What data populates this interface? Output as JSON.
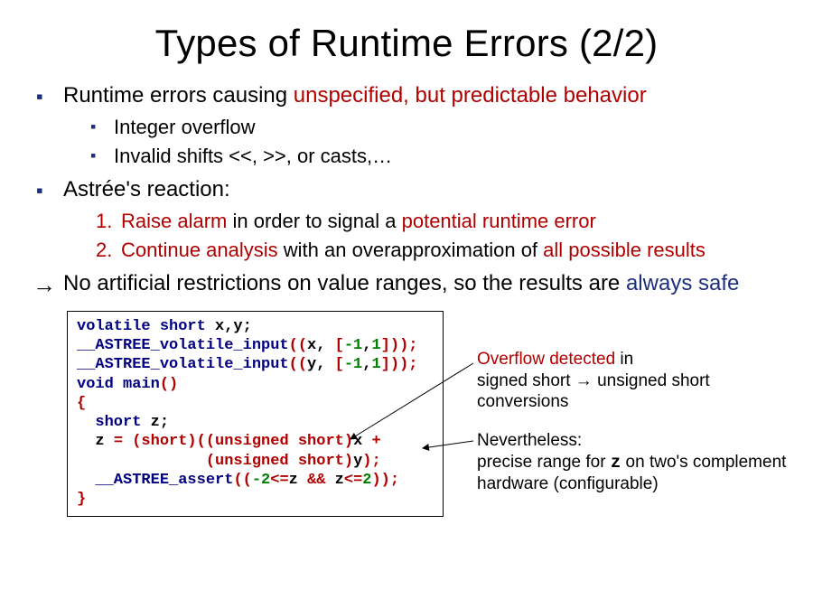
{
  "title": "Types of Runtime Errors (2/2)",
  "b1": {
    "pre": "Runtime errors causing ",
    "em": "unspecified, but predictable behavior",
    "sub1": "Integer overflow",
    "sub2": "Invalid shifts <<, >>, or casts,…"
  },
  "b2": {
    "text": "Astrée's reaction:",
    "n1a": "Raise alarm",
    "n1b": " in order to signal a ",
    "n1c": "potential runtime error",
    "n2a": "Continue analysis ",
    "n2b": "with an overapproximation of ",
    "n2c": "all possible results"
  },
  "b3": {
    "pre": "No artificial restrictions on value ranges, so the results are ",
    "em": "always safe"
  },
  "code": {
    "l1a": "volatile short ",
    "l1b": "x,y;",
    "l2a": "__ASTREE_volatile_input",
    "l2b": "((",
    "l2c": "x, ",
    "l2d": "[",
    "l2e": "-1",
    "l2f": ",",
    "l2g": "1",
    "l2h": "]));",
    "l3a": "__ASTREE_volatile_input",
    "l3b": "((",
    "l3c": "y, ",
    "l3d": "[",
    "l3e": "-1",
    "l3f": ",",
    "l3g": "1",
    "l3h": "]));",
    "l4a": "void ",
    "l4b": "main",
    "l4c": "()",
    "l5": "{",
    "l6a": "  short ",
    "l6b": "z;",
    "l7a": "  z ",
    "l7b": "= (short)((unsigned short)",
    "l7c": "x ",
    "l7d": "+",
    "l8a": "              (unsigned short)",
    "l8b": "y",
    "l8c": ");",
    "l9a": "  __ASTREE_assert",
    "l9b": "((",
    "l9c": "-2",
    "l9d": "<=",
    "l9e": "z ",
    "l9f": "&& ",
    "l9g": "z",
    "l9h": "<=",
    "l9i": "2",
    "l9j": "));",
    "l10": "}"
  },
  "note1": {
    "a": "Overflow detected ",
    "b": "in",
    "c": "signed short → unsigned short",
    "d": "conversions"
  },
  "note2": {
    "a": "Nevertheless:",
    "b1": "precise range for ",
    "b2": "z",
    "b3": " on two's complement",
    "c": "hardware (configurable)"
  }
}
